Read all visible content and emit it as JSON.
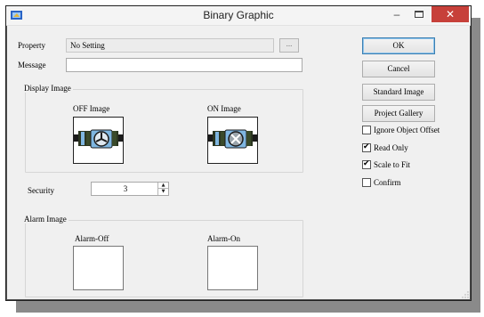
{
  "window": {
    "title": "Binary Graphic",
    "close_glyph": "✕",
    "minimize_glyph": "–"
  },
  "property": {
    "label": "Property",
    "value": "No Setting",
    "browse_label": "..."
  },
  "message": {
    "label": "Message",
    "value": ""
  },
  "display_image": {
    "group_label": "Display Image",
    "off_label": "OFF Image",
    "on_label": "ON Image"
  },
  "security": {
    "label": "Security",
    "value": "3"
  },
  "alarm_image": {
    "group_label": "Alarm Image",
    "off_label": "Alarm-Off",
    "on_label": "Alarm-On"
  },
  "buttons": {
    "ok": "OK",
    "cancel": "Cancel",
    "standard_image": "Standard Image",
    "project_gallery": "Project Gallery"
  },
  "checkboxes": [
    {
      "label": "Ignore Object Offset",
      "checked": false
    },
    {
      "label": "Read Only",
      "checked": true
    },
    {
      "label": "Scale to Fit",
      "checked": true
    },
    {
      "label": "Confirm",
      "checked": false
    }
  ],
  "colors": {
    "close_red": "#c7403a",
    "accent_blue": "#3c7fb1",
    "image_fan_blue": "#7fb6e0"
  }
}
